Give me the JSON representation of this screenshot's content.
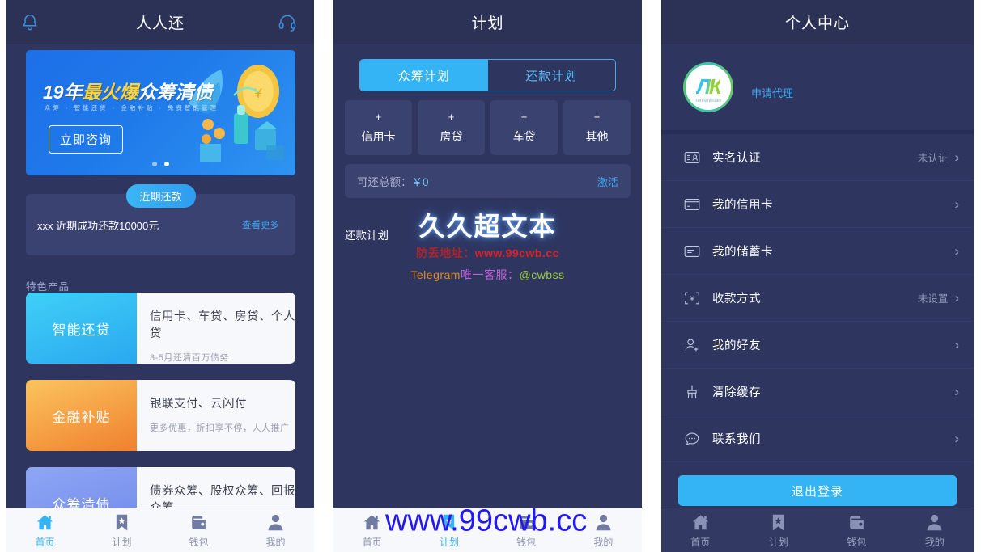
{
  "colors": {
    "panel_bg": "#2e3660",
    "header_bg": "#2b3256",
    "accent_blue": "#35b4f5",
    "link_blue": "#3ea6f0",
    "card_bg": "#3a4270",
    "tabbar_light": "#f7f8fc",
    "muted_text": "#9096b8",
    "watermark_red": "#d9222a",
    "watermark_blue": "#2419f0"
  },
  "home": {
    "header": {
      "title": "人人还",
      "left_icon": "bell-icon",
      "right_icon": "headset-icon"
    },
    "banner": {
      "title_prefix": "19年",
      "title_hot": "最火爆",
      "title_suffix": "众筹清债",
      "subtitle": "众筹 · 智能还贷 · 金融补贴 · 免费智能管理",
      "cta": "立即咨询",
      "dots": 2,
      "active_dot": 1
    },
    "recent": {
      "tag": "近期还款",
      "text": "xxx 近期成功还款10000元",
      "more": "查看更多"
    },
    "section_title": "特色产品",
    "products": [
      {
        "name": "智能还贷",
        "title": "信用卡、车贷、房贷、个人贷",
        "desc": "3-5月还清百万债务",
        "grad_from": "#3fd0f7",
        "grad_to": "#2aa8ef"
      },
      {
        "name": "金融补贴",
        "title": "银联支付、云闪付",
        "desc": "更多优惠，折扣享不停，人人推广",
        "grad_from": "#fbc45e",
        "grad_to": "#f0802f"
      },
      {
        "name": "众筹清债",
        "title": "债券众筹、股权众筹、回报众筹",
        "desc": "",
        "grad_from": "#8fa6f5",
        "grad_to": "#6f8be9"
      }
    ]
  },
  "plan": {
    "header": {
      "title": "计划"
    },
    "tabs": [
      {
        "label": "众筹计划",
        "active": true
      },
      {
        "label": "还款计划",
        "active": false
      }
    ],
    "quick_actions": [
      {
        "plus": "+",
        "label": "信用卡"
      },
      {
        "plus": "+",
        "label": "房贷"
      },
      {
        "plus": "+",
        "label": "车贷"
      },
      {
        "plus": "+",
        "label": "其他"
      }
    ],
    "total": {
      "label": "可还总额：",
      "value": "￥0",
      "action": "激活"
    },
    "subtitle": "还款计划"
  },
  "mine": {
    "header": {
      "title": "个人中心"
    },
    "profile": {
      "avatar_glyph": "ЛК",
      "avatar_sub": "renrenhuan",
      "agent_link": "申请代理"
    },
    "menu": [
      {
        "icon": "id-card-icon",
        "label": "实名认证",
        "value": "未认证",
        "chevron": "›"
      },
      {
        "icon": "credit-card-icon",
        "label": "我的信用卡",
        "value": "",
        "chevron": "›"
      },
      {
        "icon": "debit-card-icon",
        "label": "我的储蓄卡",
        "value": "",
        "chevron": "›"
      },
      {
        "icon": "yuan-scan-icon",
        "label": "收款方式",
        "value": "未设置",
        "chevron": "›"
      },
      {
        "icon": "user-add-icon",
        "label": "我的好友",
        "value": "",
        "chevron": "›"
      },
      {
        "icon": "broom-icon",
        "label": "清除缓存",
        "value": "",
        "chevron": "›"
      },
      {
        "icon": "chat-dots-icon",
        "label": "联系我们",
        "value": "",
        "chevron": "›"
      }
    ],
    "logout": "退出登录"
  },
  "tabbar": {
    "items": [
      {
        "icon": "home-icon",
        "label": "首页"
      },
      {
        "icon": "bookmark-icon",
        "label": "计划"
      },
      {
        "icon": "wallet-icon",
        "label": "钱包"
      },
      {
        "icon": "person-icon",
        "label": "我的"
      }
    ],
    "active_home": 0,
    "active_plan": 1,
    "active_mine": 3
  },
  "watermarks": {
    "center_main": "久久超文本",
    "center_url_label": "防丢地址：",
    "center_url": "www.99cwb.cc",
    "center_tg_a": "Telegram",
    "center_tg_b": "唯一客服：",
    "center_tg_c": "@cwbss",
    "bottom": "www.99cwb.cc"
  }
}
